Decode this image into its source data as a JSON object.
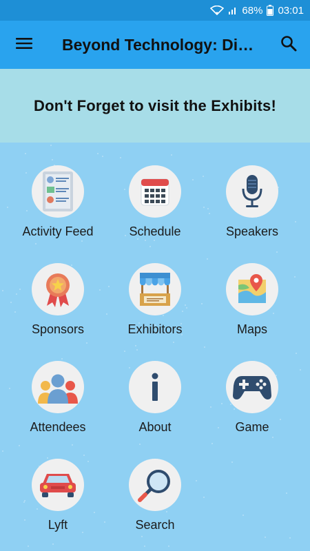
{
  "status_bar": {
    "battery": "68%",
    "time": "03:01"
  },
  "app_bar": {
    "title": "Beyond Technology:  Di…",
    "menu_icon": "hamburger-menu-icon",
    "search_icon": "search-icon"
  },
  "banner": {
    "text": "Don't Forget to visit the Exhibits!"
  },
  "tiles": [
    {
      "label": "Activity Feed",
      "icon": "activity-feed-icon"
    },
    {
      "label": "Schedule",
      "icon": "calendar-icon"
    },
    {
      "label": "Speakers",
      "icon": "microphone-icon"
    },
    {
      "label": "Sponsors",
      "icon": "award-ribbon-icon"
    },
    {
      "label": "Exhibitors",
      "icon": "booth-icon"
    },
    {
      "label": "Maps",
      "icon": "map-pin-icon"
    },
    {
      "label": "Attendees",
      "icon": "people-icon"
    },
    {
      "label": "About",
      "icon": "info-icon"
    },
    {
      "label": "Game",
      "icon": "gamepad-icon"
    },
    {
      "label": "Lyft",
      "icon": "car-icon"
    },
    {
      "label": "Search",
      "icon": "magnifier-icon"
    }
  ],
  "colors": {
    "status_bar": "#1e8fd6",
    "app_bar": "#29a3ee",
    "banner": "#a7dde8",
    "background": "#8fd0f3"
  }
}
